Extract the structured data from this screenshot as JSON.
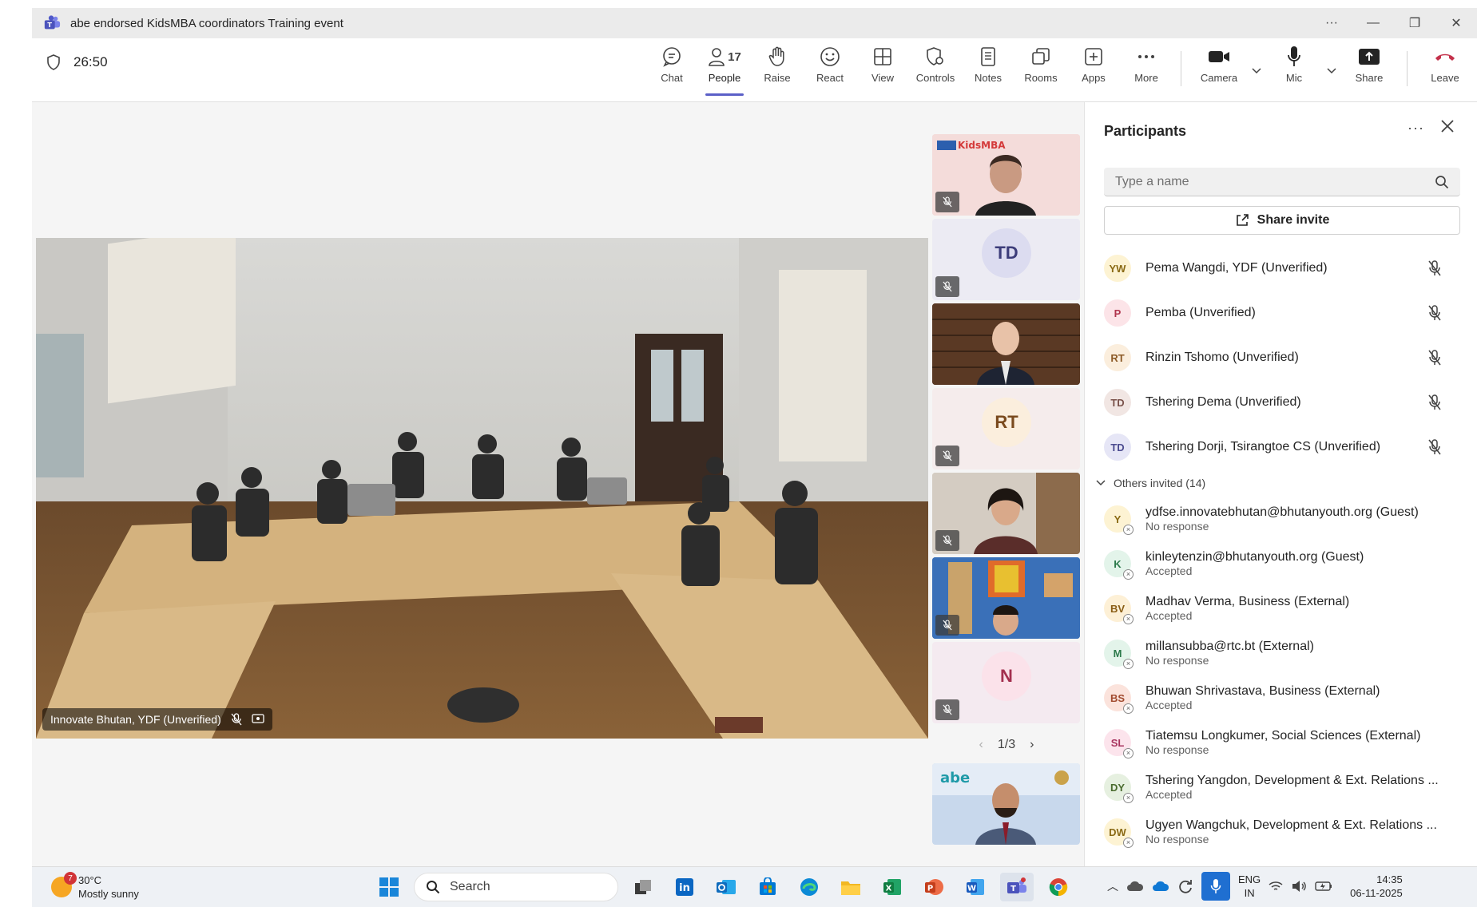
{
  "window": {
    "title": "abe endorsed KidsMBA coordinators Training event",
    "controls": [
      "more",
      "minimize",
      "maximize",
      "close"
    ]
  },
  "meeting": {
    "timer": "26:50",
    "toolbar": [
      {
        "id": "chat",
        "label": "Chat",
        "icon": "chat-icon"
      },
      {
        "id": "people",
        "label": "People",
        "icon": "people-icon",
        "count": "17",
        "active": true
      },
      {
        "id": "raise",
        "label": "Raise",
        "icon": "hand-icon"
      },
      {
        "id": "react",
        "label": "React",
        "icon": "smiley-icon"
      },
      {
        "id": "view",
        "label": "View",
        "icon": "grid-icon"
      },
      {
        "id": "controls",
        "label": "Controls",
        "icon": "shield-gear-icon"
      },
      {
        "id": "notes",
        "label": "Notes",
        "icon": "notes-icon"
      },
      {
        "id": "rooms",
        "label": "Rooms",
        "icon": "rooms-icon"
      },
      {
        "id": "apps",
        "label": "Apps",
        "icon": "plus-icon"
      },
      {
        "id": "more",
        "label": "More",
        "icon": "ellipsis-icon"
      }
    ],
    "media": {
      "camera": "Camera",
      "mic": "Mic",
      "share": "Share",
      "leave": "Leave"
    }
  },
  "stage": {
    "main_speaker": "Innovate Bhutan, YDF (Unverified)",
    "tiles": [
      {
        "type": "video",
        "logo": "KidsMBA"
      },
      {
        "type": "avatar",
        "initials": "TD"
      },
      {
        "type": "video"
      },
      {
        "type": "avatar",
        "initials": "RT"
      },
      {
        "type": "video"
      },
      {
        "type": "video"
      },
      {
        "type": "avatar",
        "initials": "N"
      }
    ],
    "pager": "1/3",
    "self_logo": "abe"
  },
  "participants": {
    "title": "Participants",
    "search_placeholder": "Type a name",
    "share_invite": "Share invite",
    "in_meeting": [
      {
        "initials": "YW",
        "name": "Pema Wangdi, YDF (Unverified)",
        "bg": "#fdf3d3",
        "fg": "#8a6a14"
      },
      {
        "initials": "P",
        "name": "Pemba (Unverified)",
        "bg": "#fce4e8",
        "fg": "#b0344d"
      },
      {
        "initials": "RT",
        "name": "Rinzin Tshomo (Unverified)",
        "bg": "#fbeedd",
        "fg": "#8c5a26"
      },
      {
        "initials": "TD",
        "name": "Tshering Dema (Unverified)",
        "bg": "#f1e6e3",
        "fg": "#7a524b"
      },
      {
        "initials": "TD",
        "name": "Tshering Dorji, Tsirangtoe CS (Unverified)",
        "bg": "#e6e6f6",
        "fg": "#4b4b8f"
      }
    ],
    "others_header": "Others invited (14)",
    "others": [
      {
        "initials": "Y",
        "name": "ydfse.innovatebhutan@bhutanyouth.org (Guest)",
        "status": "No response",
        "bg": "#fdf3d3",
        "fg": "#8a6a14"
      },
      {
        "initials": "K",
        "name": "kinleytenzin@bhutanyouth.org (Guest)",
        "status": "Accepted",
        "bg": "#e3f4ea",
        "fg": "#2c7a4b"
      },
      {
        "initials": "BV",
        "name": "Madhav Verma, Business (External)",
        "status": "Accepted",
        "bg": "#fdf0d6",
        "fg": "#8a5d14"
      },
      {
        "initials": "M",
        "name": "millansubba@rtc.bt (External)",
        "status": "No response",
        "bg": "#e3f4ea",
        "fg": "#2c7a4b"
      },
      {
        "initials": "BS",
        "name": "Bhuwan Shrivastava, Business (External)",
        "status": "Accepted",
        "bg": "#fbe3dc",
        "fg": "#a14a2e"
      },
      {
        "initials": "SL",
        "name": "Tiatemsu Longkumer, Social Sciences (External)",
        "status": "No response",
        "bg": "#fce4ec",
        "fg": "#a8345f"
      },
      {
        "initials": "DY",
        "name": "Tshering Yangdon, Development & Ext. Relations ...",
        "status": "Accepted",
        "bg": "#e6f0e0",
        "fg": "#4a6b2e"
      },
      {
        "initials": "DW",
        "name": "Ugyen Wangchuk, Development & Ext. Relations ...",
        "status": "No response",
        "bg": "#fdf3d3",
        "fg": "#8a6a14"
      }
    ]
  },
  "taskbar": {
    "weather_temp": "30°C",
    "weather_desc": "Mostly sunny",
    "weather_badge": "7",
    "search_label": "Search",
    "lang_top": "ENG",
    "lang_bottom": "IN",
    "time": "14:35",
    "date": "06-11-2025"
  },
  "colors": {
    "accent": "#5b5fc7",
    "leave": "#c4314b",
    "taskbar_mic": "#1f6fd1"
  }
}
